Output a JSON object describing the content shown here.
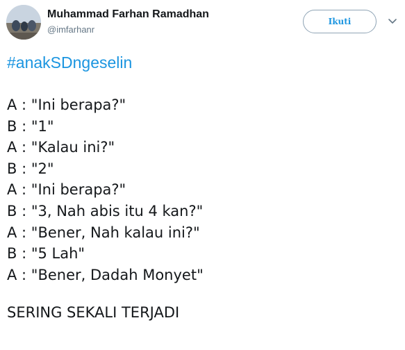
{
  "author": {
    "name": "Muhammad Farhan Ramadhan",
    "handle": "@imfarhanr"
  },
  "follow_button": {
    "label": "Ikuti"
  },
  "icons": {
    "avatar": "profile-photo",
    "menu": "chevron-down-icon"
  },
  "colors": {
    "link": "#1b95e0",
    "text": "#14171a",
    "secondary": "#657786"
  },
  "tweet": {
    "hashtag": "#anakSDngeselin",
    "lines": [
      "A : \"Ini berapa?\"",
      "B : \"1\"",
      "A : \"Kalau ini?\"",
      "B : \"2\"",
      "A : \"Ini berapa?\"",
      "B : \"3, Nah abis itu 4 kan?\"",
      "A : \"Bener, Nah kalau ini?\"",
      "B : \"5 Lah\"",
      "A : \"Bener, Dadah Monyet\""
    ],
    "footer": "SERING SEKALI TERJADI"
  }
}
